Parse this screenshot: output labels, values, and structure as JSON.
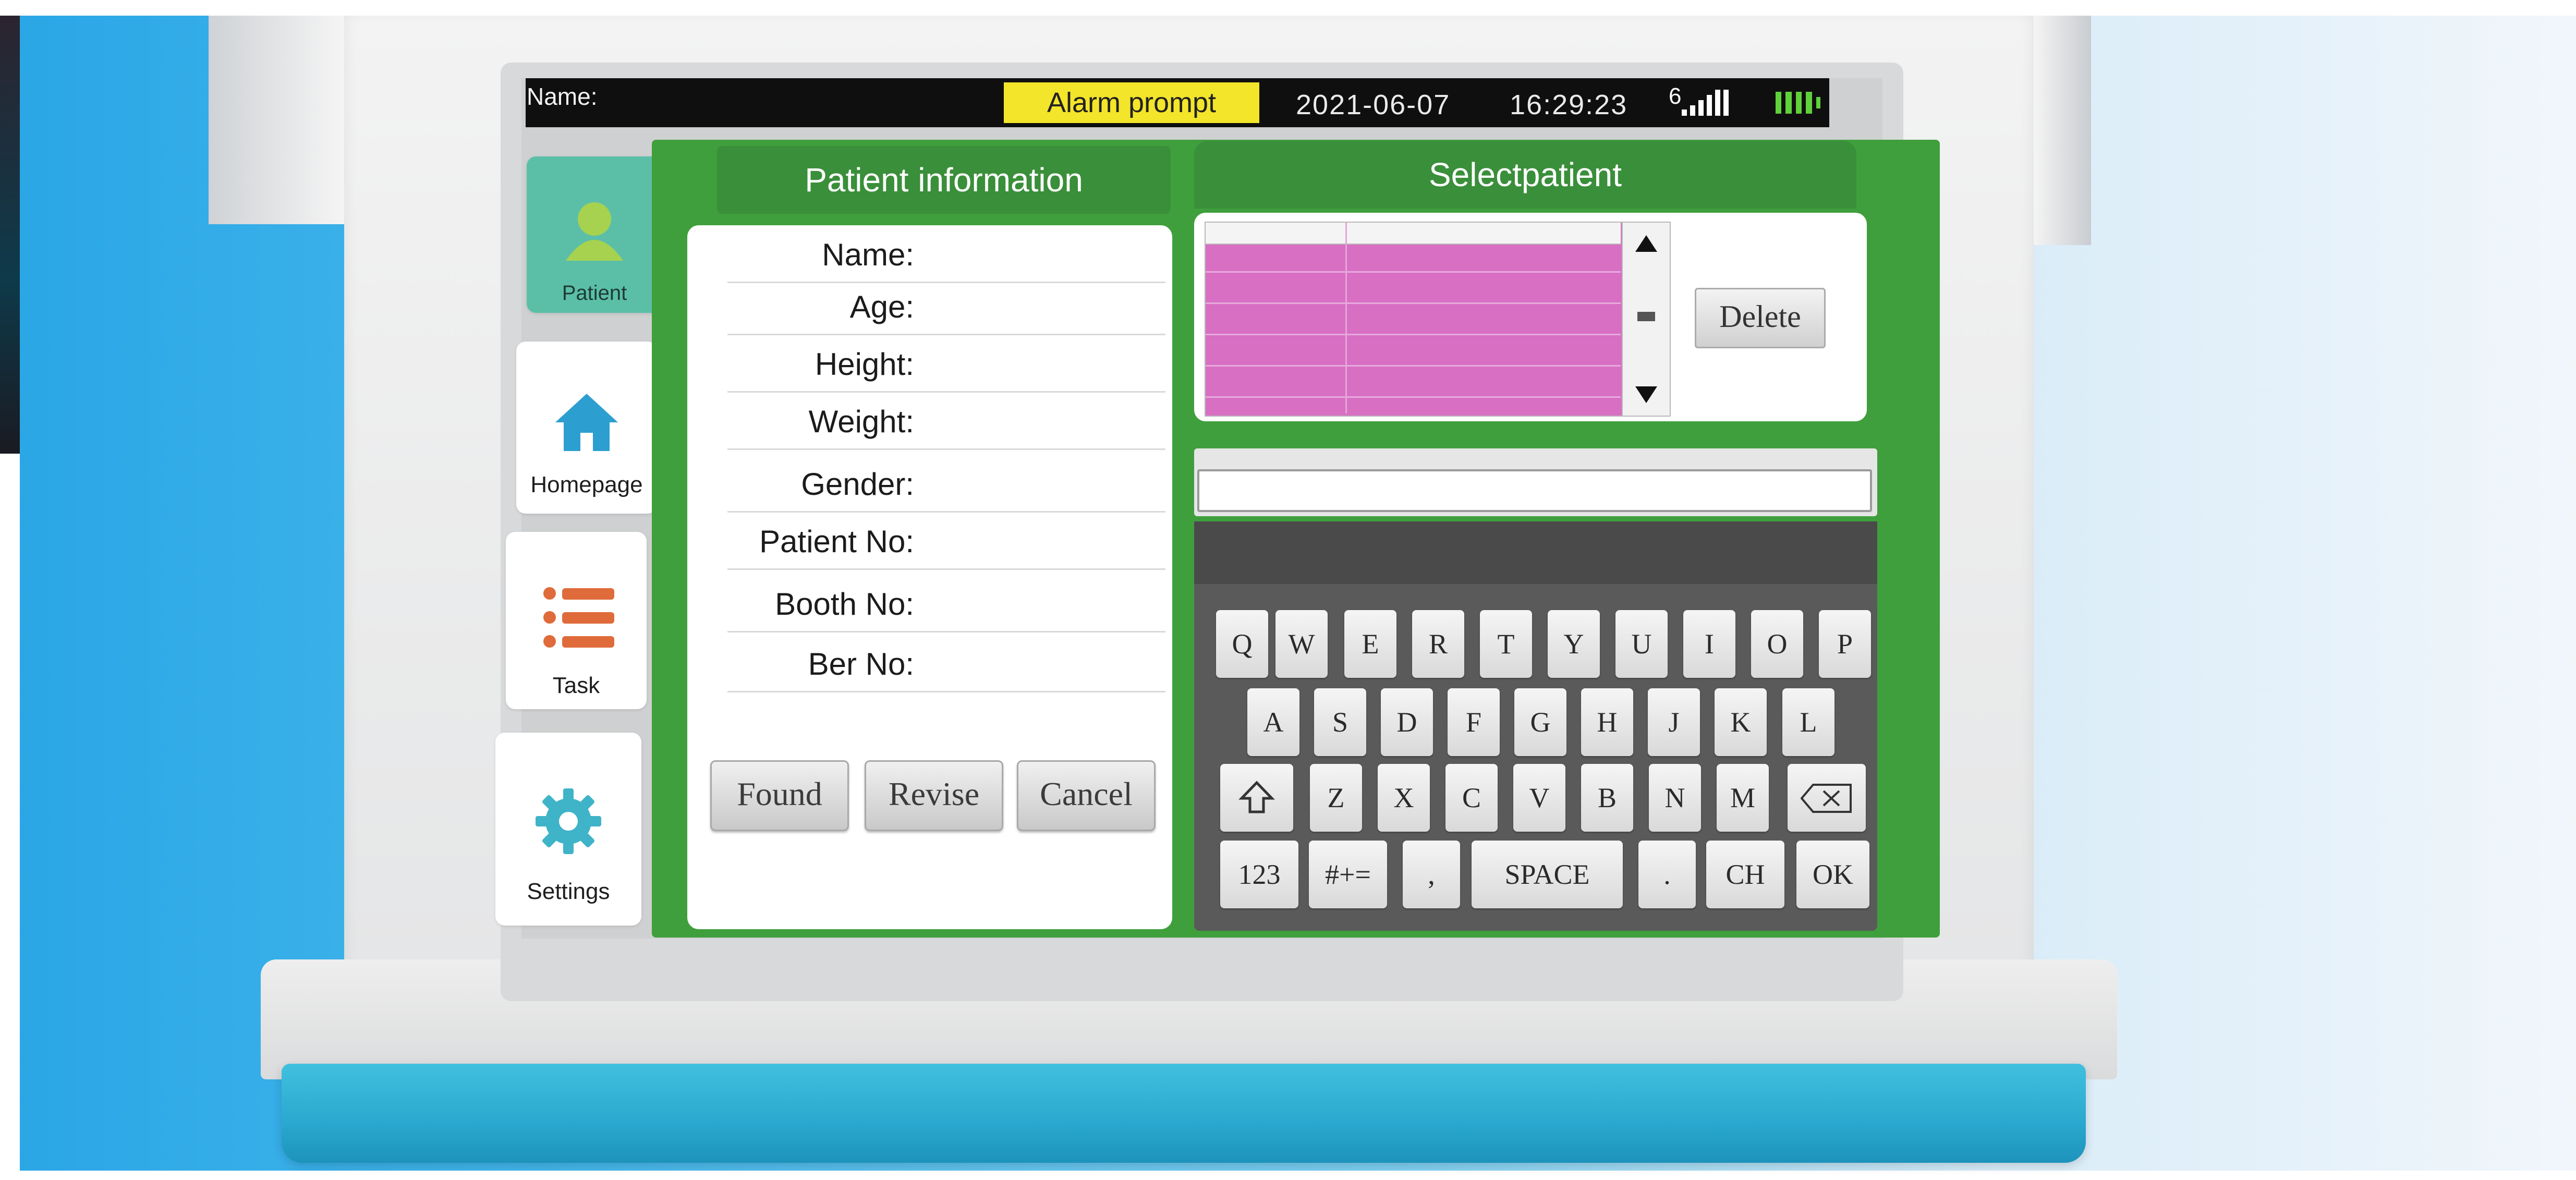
{
  "status_bar": {
    "name_label": "Name:",
    "alarm": "Alarm prompt",
    "date": "2021-06-07",
    "time": "16:29:23",
    "signal_number": "6",
    "battery_color": "#5fd13a"
  },
  "sidebar": {
    "items": [
      {
        "label": "Patient",
        "icon": "person-icon",
        "active": true
      },
      {
        "label": "Homepage",
        "icon": "home-icon",
        "active": false
      },
      {
        "label": "Task",
        "icon": "list-icon",
        "active": false
      },
      {
        "label": "Settings",
        "icon": "gear-icon",
        "active": false
      }
    ]
  },
  "patient_info": {
    "title": "Patient information",
    "fields": [
      "Name:",
      "Age:",
      "Height:",
      "Weight:",
      "Gender:",
      "Patient No:",
      "Booth No:",
      "Ber No:"
    ],
    "buttons": {
      "found": "Found",
      "revise": "Revise",
      "cancel": "Cancel"
    }
  },
  "select_patient": {
    "title": "Selectpatient",
    "delete_label": "Delete",
    "search_value": ""
  },
  "keyboard": {
    "row1": [
      "Q",
      "W",
      "E",
      "R",
      "T",
      "Y",
      "U",
      "I",
      "O",
      "P"
    ],
    "row2": [
      "A",
      "S",
      "D",
      "F",
      "G",
      "H",
      "J",
      "K",
      "L"
    ],
    "row3": [
      "Z",
      "X",
      "C",
      "V",
      "B",
      "N",
      "M"
    ],
    "row4": {
      "num": "123",
      "sym": "#+=",
      "comma": ",",
      "space": "SPACE",
      "period": ".",
      "lang": "CH",
      "ok": "OK"
    }
  },
  "colors": {
    "panel_green": "#3f9f3c",
    "header_green": "#3a8f3a",
    "active_nav": "#5bbfa8",
    "table_pink": "#d86fc3",
    "alarm_yellow": "#f3e52a",
    "base_cyan": "#2aa8cf"
  }
}
